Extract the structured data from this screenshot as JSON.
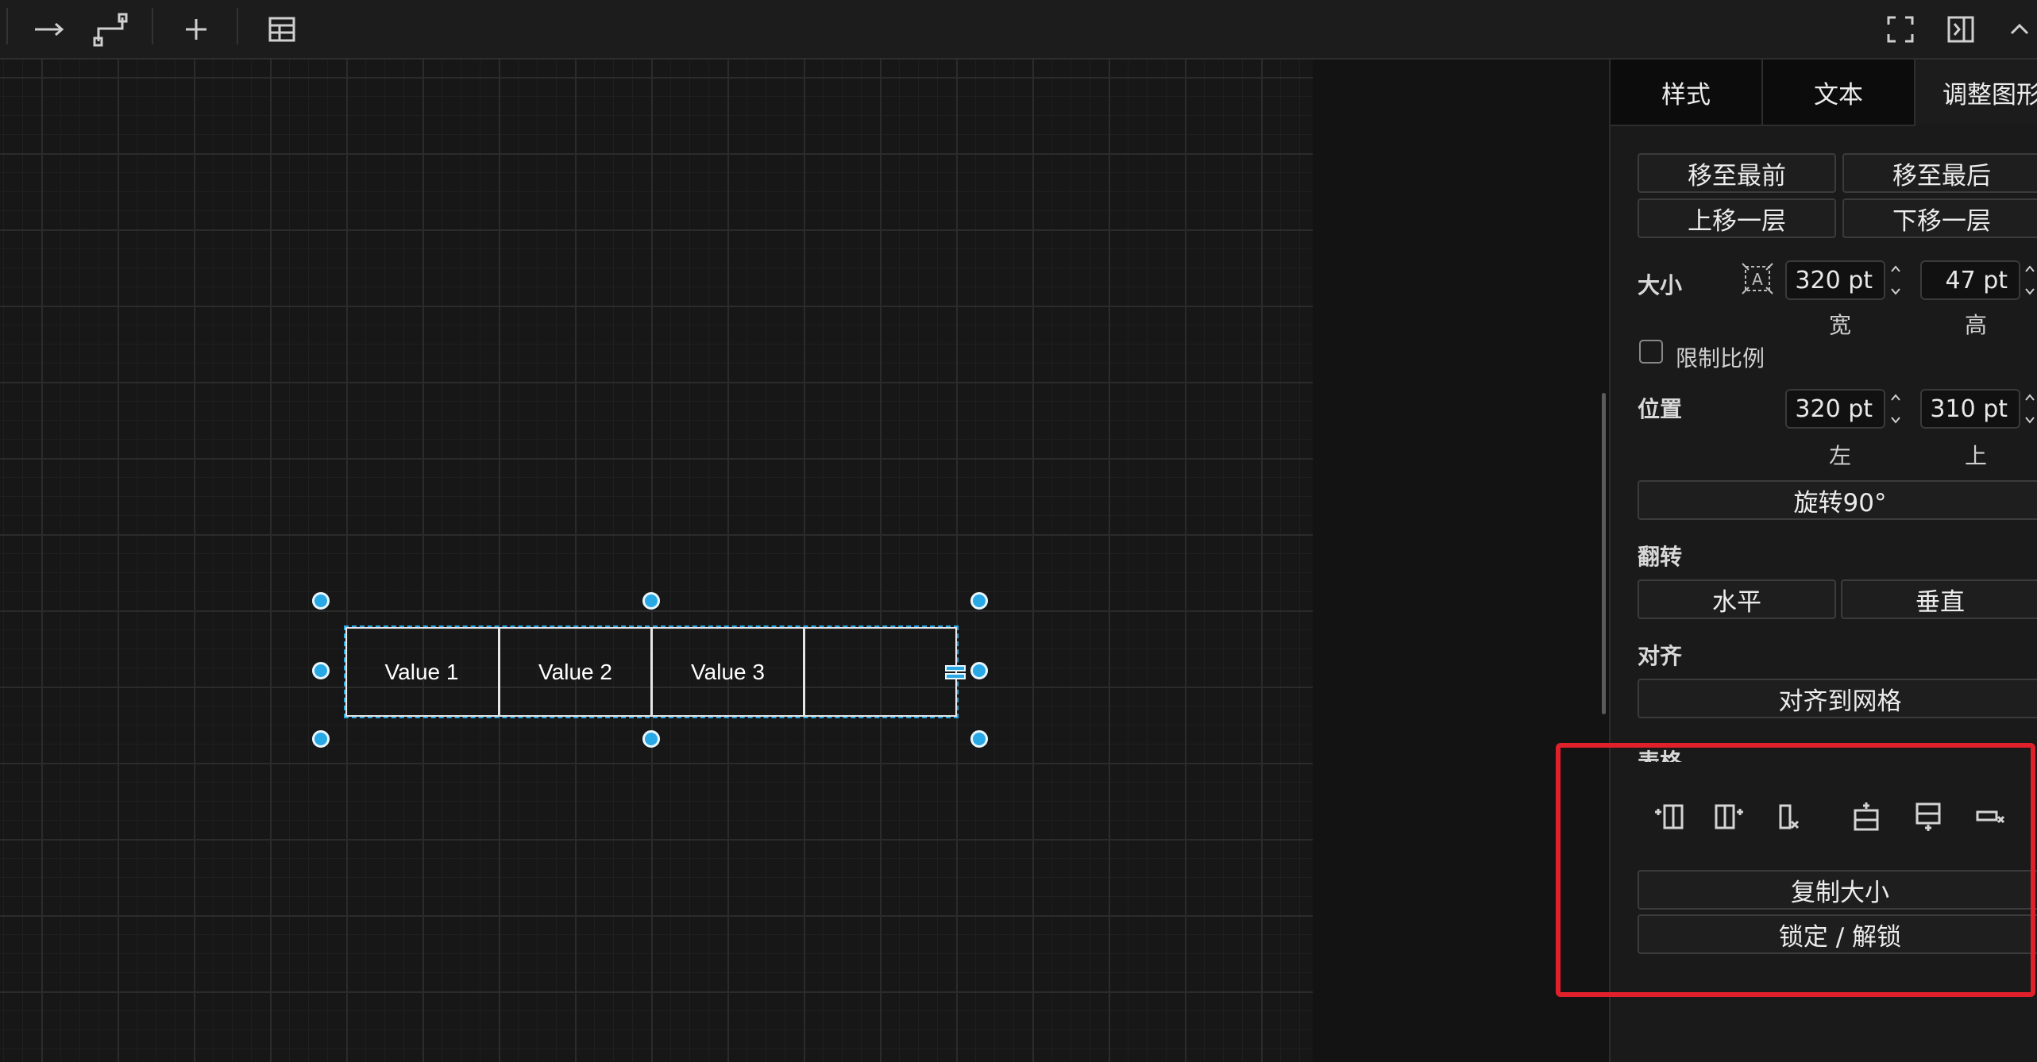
{
  "toolbar": {
    "icons": [
      "arrow-right-icon",
      "waypoint-connector-icon",
      "plus-icon",
      "table-icon",
      "fullscreen-icon",
      "format-panel-icon",
      "chevron-up-icon"
    ]
  },
  "canvas": {
    "table": {
      "cells": [
        "Value 1",
        "Value 2",
        "Value 3",
        ""
      ]
    }
  },
  "panel": {
    "tabs": [
      "样式",
      "文本",
      "调整图形"
    ],
    "active_tab": "调整图形",
    "arrange": {
      "to_front": "移至最前",
      "to_back": "移至最后",
      "bring_forward": "上移一层",
      "send_backward": "下移一层"
    },
    "size": {
      "label": "大小",
      "width": "320 pt",
      "height": "47 pt",
      "width_label": "宽",
      "height_label": "高",
      "constrain_label": "限制比例",
      "constrain_checked": false
    },
    "position": {
      "label": "位置",
      "left": "320 pt",
      "top": "310 pt",
      "left_label": "左",
      "top_label": "上"
    },
    "rotate_button": "旋转90°",
    "flip": {
      "label": "翻转",
      "horizontal": "水平",
      "vertical": "垂直"
    },
    "align": {
      "label": "对齐",
      "snap_to_grid": "对齐到网格"
    },
    "table_section": {
      "label": "表格",
      "icons": [
        "insert-column-before-icon",
        "insert-column-after-icon",
        "delete-column-icon",
        "insert-row-before-icon",
        "insert-row-after-icon",
        "delete-row-icon"
      ]
    },
    "copy_size": "复制大小",
    "lock_unlock": "锁定 / 解锁"
  },
  "colors": {
    "accent": "#29a8e6",
    "highlight": "#e0202a",
    "background": "#121212"
  }
}
